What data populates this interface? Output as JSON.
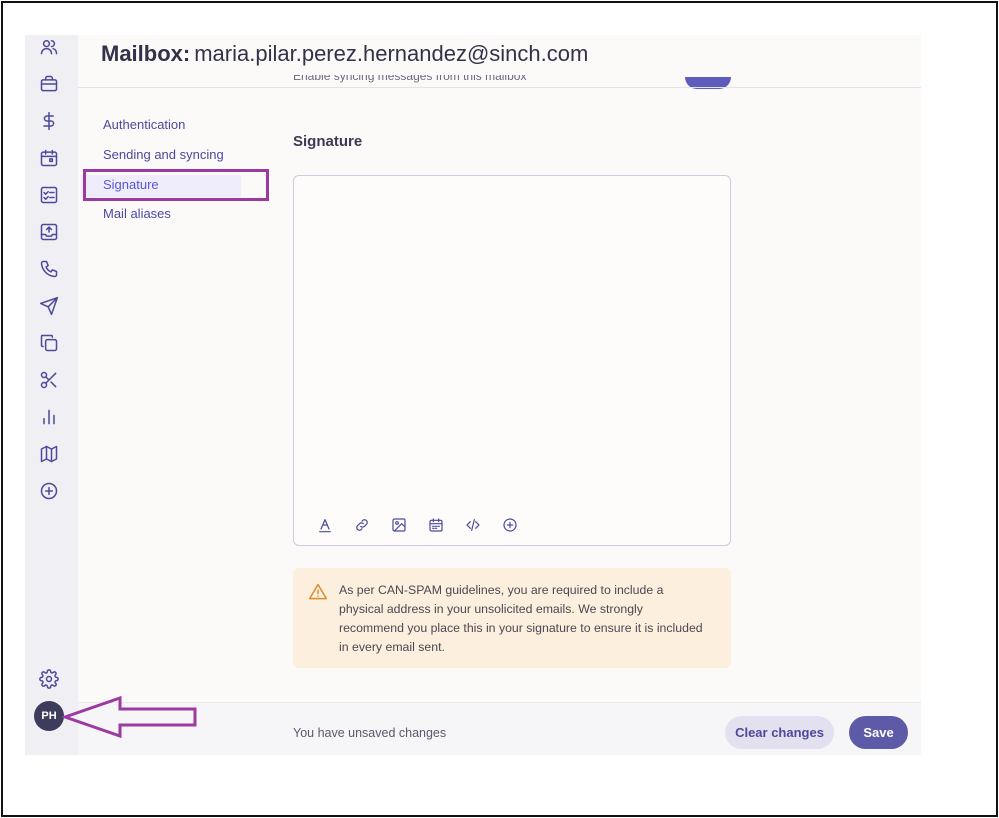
{
  "header": {
    "title_label": "Mailbox:",
    "title_address": "maria.pilar.perez.hernandez@sinch.com"
  },
  "scrolled_setting": {
    "label": "Enable syncing messages from this mailbox",
    "toggle_on": true
  },
  "subnav": {
    "items": [
      {
        "label": "Authentication"
      },
      {
        "label": "Sending and syncing"
      },
      {
        "label": "Signature",
        "active": true
      },
      {
        "label": "Mail aliases"
      }
    ]
  },
  "sidebar": {
    "icons": [
      "contacts-icon",
      "briefcase-icon",
      "dollar-icon",
      "calendar-icon",
      "tasks-icon",
      "inbox-upload-icon",
      "phone-icon",
      "send-icon",
      "copy-icon",
      "scissors-icon",
      "bar-chart-icon",
      "map-icon",
      "add-circle-icon"
    ],
    "settings_icon": "gear-icon",
    "avatar_initials": "PH"
  },
  "signature": {
    "title": "Signature",
    "toolbar": [
      "text-format-icon",
      "link-icon",
      "image-icon",
      "calendar-icon",
      "code-icon",
      "add-circle-icon"
    ]
  },
  "alert": {
    "icon": "warning-icon",
    "text": "As per CAN-SPAM guidelines, you are required to include a physical address in your unsolicited emails. We strongly recommend you place this in your signature to ensure it is included in every email sent."
  },
  "footer": {
    "status": "You have unsaved changes",
    "clear_label": "Clear changes",
    "save_label": "Save"
  },
  "colors": {
    "accent": "#5d5aa8",
    "highlight": "#9b3aa0",
    "alert_bg": "#fcefdd",
    "alert_icon": "#e08a2a"
  }
}
